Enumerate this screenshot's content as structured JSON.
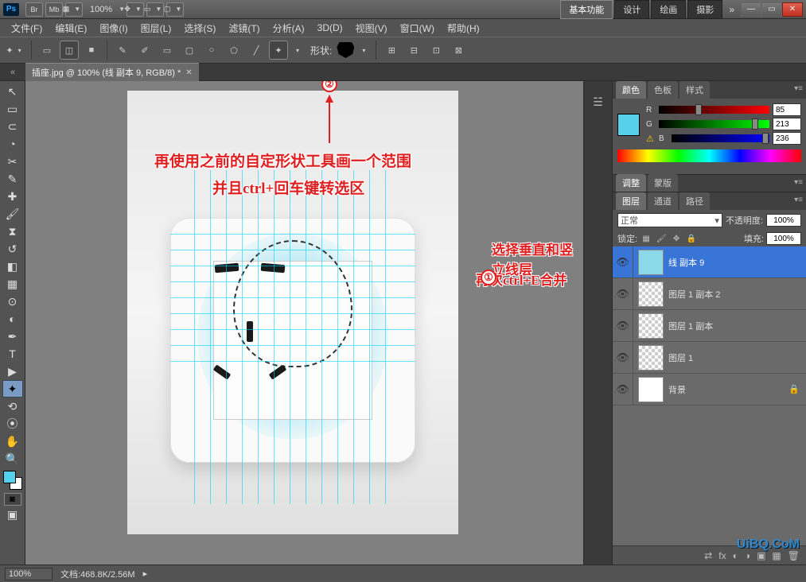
{
  "titlebar": {
    "app": "Ps",
    "btns": [
      "Br",
      "Mb"
    ],
    "zoom": "100%",
    "workspaces": [
      {
        "label": "基本功能",
        "active": true
      },
      {
        "label": "设计",
        "active": false
      },
      {
        "label": "绘画",
        "active": false
      },
      {
        "label": "摄影",
        "active": false
      }
    ]
  },
  "menubar": [
    "文件(F)",
    "编辑(E)",
    "图像(I)",
    "图层(L)",
    "选择(S)",
    "滤镜(T)",
    "分析(A)",
    "3D(D)",
    "视图(V)",
    "窗口(W)",
    "帮助(H)"
  ],
  "optionsbar": {
    "shape_label": "形状:"
  },
  "doc_tab": {
    "title": "插座.jpg @ 100% (线 副本 9, RGB/8) *"
  },
  "annotations": {
    "line1": "再使用之前的自定形状工具画一个范围",
    "line2": "并且ctrl+回车键转选区",
    "line3": "选择垂直和竖立线层",
    "line4": "再次ctrl+E合并",
    "marker1": "①",
    "marker2": "②"
  },
  "panels": {
    "color": {
      "tabs": [
        "颜色",
        "色板",
        "样式"
      ],
      "active": 0,
      "channels": [
        {
          "label": "R",
          "value": "85",
          "pct": 33
        },
        {
          "label": "G",
          "value": "213",
          "pct": 84
        },
        {
          "label": "B",
          "value": "236",
          "pct": 93
        }
      ]
    },
    "adjust": {
      "tabs": [
        "调整",
        "蒙版"
      ]
    },
    "layers": {
      "tabs": [
        "图层",
        "通道",
        "路径"
      ],
      "active": 0,
      "blend_mode": "正常",
      "opacity_label": "不透明度:",
      "opacity_value": "100%",
      "lock_label": "锁定:",
      "fill_label": "填充:",
      "fill_value": "100%",
      "items": [
        {
          "name": "线 副本 9",
          "selected": true,
          "visible": true,
          "thumb": "solid"
        },
        {
          "name": "图层 1 副本 2",
          "selected": false,
          "visible": true,
          "thumb": "trans"
        },
        {
          "name": "图层 1 副本",
          "selected": false,
          "visible": true,
          "thumb": "trans"
        },
        {
          "name": "图层 1",
          "selected": false,
          "visible": true,
          "thumb": "trans"
        },
        {
          "name": "背景",
          "selected": false,
          "visible": true,
          "thumb": "white",
          "locked": true
        }
      ]
    }
  },
  "statusbar": {
    "zoom": "100%",
    "doc_info": "文档:468.8K/2.56M"
  },
  "watermark": "UiBQ.CoM"
}
